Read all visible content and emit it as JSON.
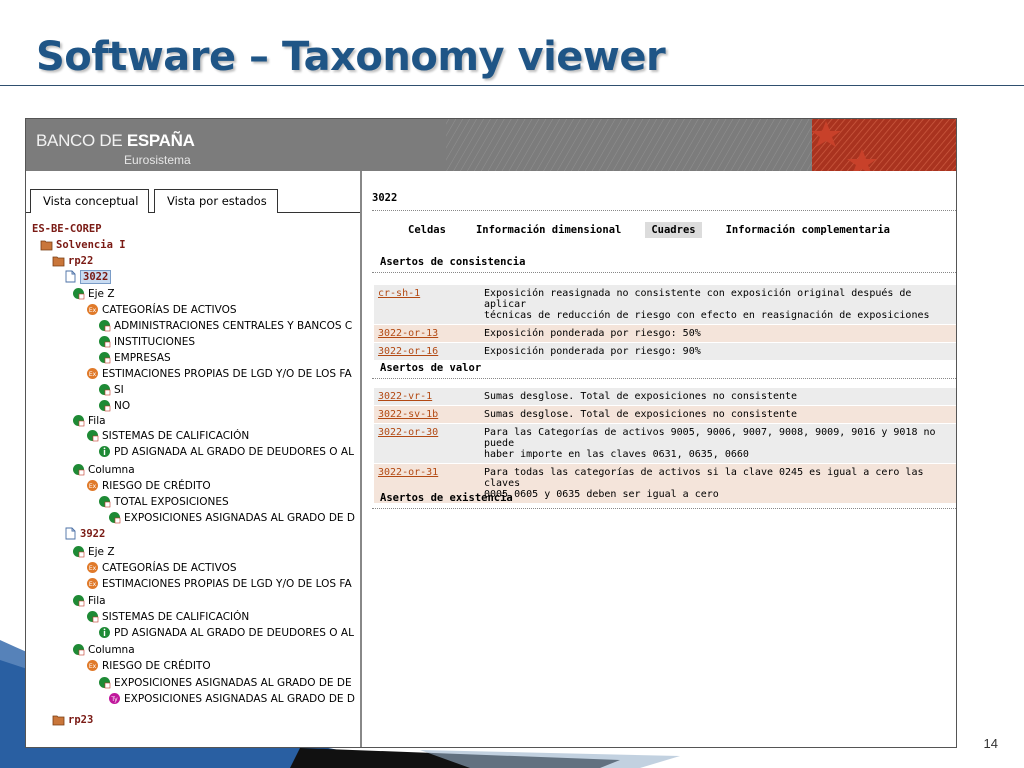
{
  "slide": {
    "title": "Software – Taxonomy viewer",
    "page_number": "14"
  },
  "app": {
    "brand_light": "BANCO DE ",
    "brand_bold": "ESPAÑA",
    "brand_sub": "Eurosistema"
  },
  "tabs": [
    {
      "label": "Vista conceptual"
    },
    {
      "label": "Vista por estados"
    }
  ],
  "tree": {
    "root": "ES-BE-COREP",
    "solvencia": "Solvencia I",
    "rp22": "rp22",
    "n3022": "3022",
    "ejez_1": "Eje Z",
    "cat_activos_1": "CATEGORÍAS DE ACTIVOS",
    "admin_centrales": "ADMINISTRACIONES CENTRALES Y BANCOS C",
    "instituciones": "INSTITUCIONES",
    "empresas": "EMPRESAS",
    "estim_lgd_1": "ESTIMACIONES PROPIAS DE LGD Y/O DE LOS FA",
    "si": "SI",
    "no": "NO",
    "fila_1": "Fila",
    "sist_calif_1": "SISTEMAS DE CALIFICACIÓN",
    "pd_asignada_1": "PD ASIGNADA AL GRADO DE DEUDORES O AL",
    "columna_1": "Columna",
    "riesgo_credito_1": "RIESGO DE CRÉDITO",
    "total_expos": "TOTAL EXPOSICIONES",
    "expos_asign_1": "EXPOSICIONES ASIGNADAS AL GRADO DE D",
    "n3922": "3922",
    "ejez_2": "Eje Z",
    "cat_activos_2": "CATEGORÍAS DE ACTIVOS",
    "estim_lgd_2": "ESTIMACIONES PROPIAS DE LGD Y/O DE LOS FA",
    "fila_2": "Fila",
    "sist_calif_2": "SISTEMAS DE CALIFICACIÓN",
    "pd_asignada_2": "PD ASIGNADA AL GRADO DE DEUDORES O AL",
    "columna_2": "Columna",
    "riesgo_credito_2": "RIESGO DE CRÉDITO",
    "expos_asign_2": "EXPOSICIONES ASIGNADAS AL GRADO DE DE",
    "expos_asign_3": "EXPOSICIONES ASIGNADAS AL GRADO DE D",
    "rp23": "rp23"
  },
  "detail": {
    "title": "3022",
    "nav": [
      "Celdas",
      "Información dimensional",
      "Cuadres",
      "Información complementaria"
    ],
    "active_nav": "Cuadres",
    "consistencia_title": "Asertos de consistencia",
    "consistencia_rows": [
      {
        "code": "cr-sh-1",
        "desc_line1": "Exposición reasignada no consistente con exposición original después de aplicar",
        "desc_line2": "técnicas de reducción de riesgo con efecto en reasignación de exposiciones"
      },
      {
        "code": "3022-or-13",
        "desc_line1": "Exposición ponderada por riesgo: 50%",
        "desc_line2": ""
      },
      {
        "code": "3022-or-16",
        "desc_line1": "Exposición ponderada por riesgo: 90%",
        "desc_line2": ""
      }
    ],
    "valor_title": "Asertos de valor",
    "valor_rows": [
      {
        "code": "3022-vr-1",
        "desc_line1": "Sumas desglose. Total de exposiciones no consistente",
        "desc_line2": ""
      },
      {
        "code": "3022-sv-1b",
        "desc_line1": "Sumas desglose. Total de exposiciones no consistente",
        "desc_line2": ""
      },
      {
        "code": "3022-or-30",
        "desc_line1": "Para las Categorías de activos 9005, 9006, 9007, 9008, 9009, 9016 y 9018 no puede",
        "desc_line2": "haber importe en las claves 0631, 0635, 0660"
      },
      {
        "code": "3022-or-31",
        "desc_line1": "Para todas las categorías de activos si la clave 0245 es igual a cero las claves",
        "desc_line2": "0005,0605 y 0635 deben ser igual a cero"
      }
    ],
    "existencia_title": "Asertos de existencia"
  },
  "colors": {
    "title_blue": "#1f5586",
    "header_grey": "#7a7a7a",
    "flag_red": "#b43a26",
    "link_orange": "#b34a14",
    "row_grey": "#ececec",
    "row_pink": "#f4e4da"
  }
}
